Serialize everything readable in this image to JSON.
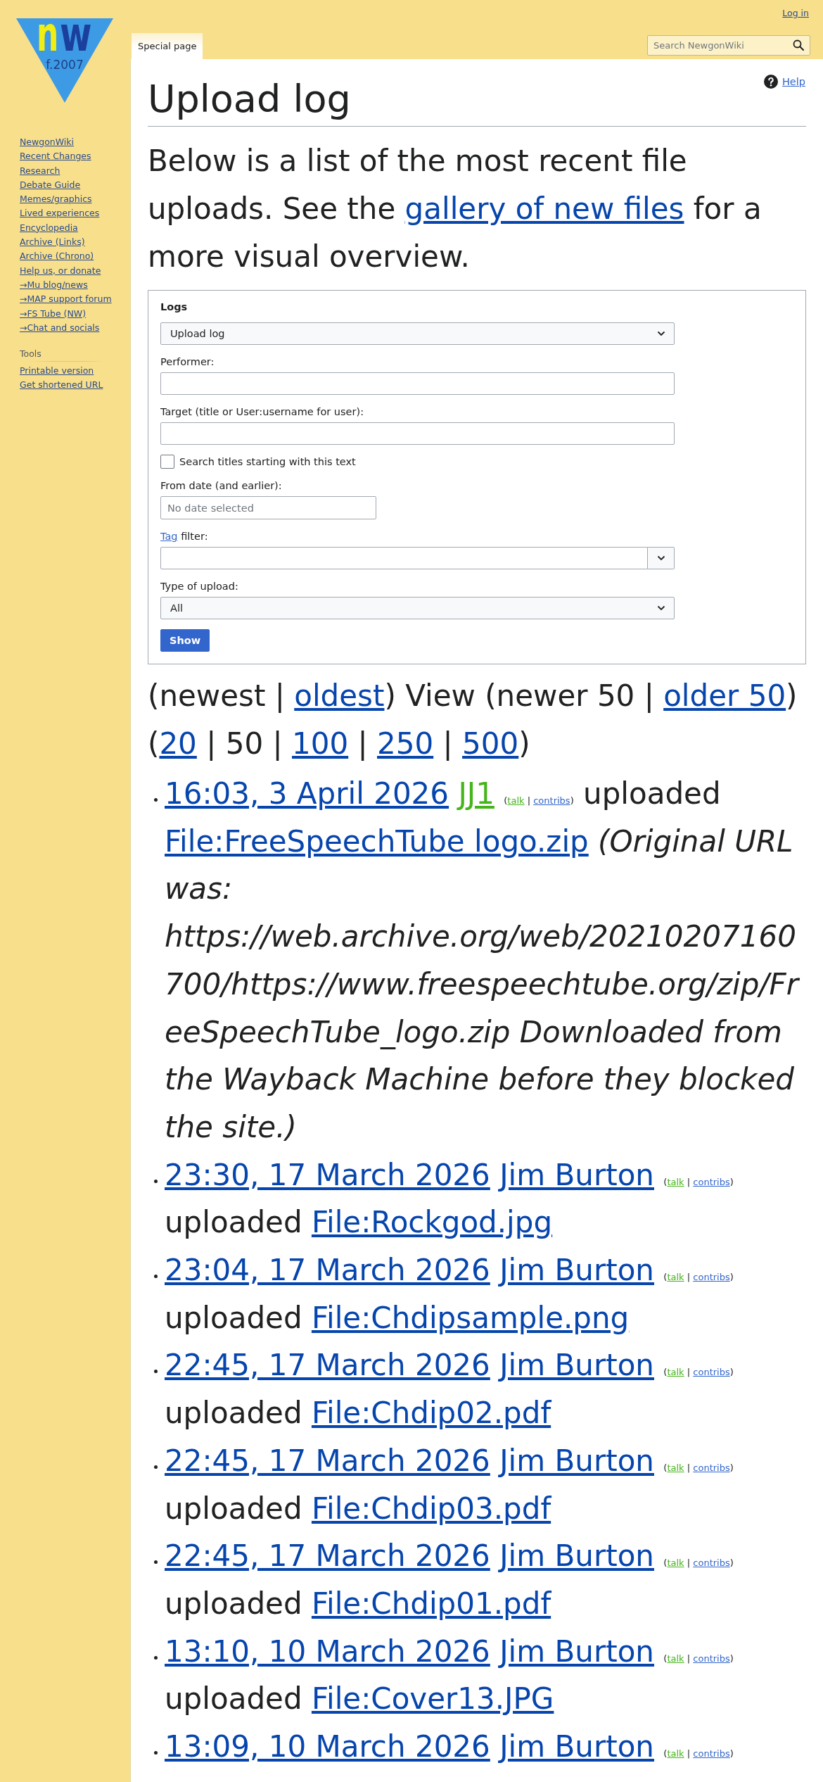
{
  "header": {
    "login": "Log in",
    "tabs": [
      {
        "label": "Special page",
        "selected": true
      }
    ],
    "search": {
      "placeholder": "Search NewgonWiki"
    }
  },
  "logo": {
    "letters": [
      {
        "text": "n",
        "color": "#f0ee12"
      },
      {
        "text": "w",
        "color": "#1b3f9c"
      }
    ],
    "caption": "f.2007"
  },
  "sidebar": {
    "navigation": [
      "NewgonWiki",
      "Recent Changes",
      "Research",
      "Debate Guide",
      "Memes/graphics",
      "Lived experiences",
      "Encyclopedia",
      "Archive (Links)",
      "Archive (Chrono)",
      "Help us, or donate",
      "→Mu blog/news",
      "→MAP support forum",
      "→FS Tube (NW)",
      "→Chat and socials"
    ],
    "tools": {
      "heading": "Tools",
      "items": [
        "Printable version",
        "Get shortened URL"
      ]
    }
  },
  "page": {
    "title": "Upload log",
    "help": "Help",
    "intro": [
      {
        "kind": "text",
        "text": "Below is a list of the most recent file uploads. See the "
      },
      {
        "kind": "link",
        "text": "gallery of new files"
      },
      {
        "kind": "text",
        "text": " for a more visual overview."
      }
    ]
  },
  "filter_form": {
    "title": "Logs",
    "fields": [
      {
        "kind": "select",
        "value": "Upload log"
      },
      {
        "kind": "text",
        "label": "Performer:"
      },
      {
        "kind": "text",
        "label": "Target (title or User:username for user):"
      },
      {
        "kind": "checkbox",
        "label": "Search titles starting with this text",
        "checked": false
      },
      {
        "kind": "date",
        "label": "From date (and earlier):",
        "placeholder": "No date selected"
      },
      {
        "kind": "combo",
        "label_link": "Tag",
        "label": "filter:"
      },
      {
        "kind": "select",
        "label": "Type of upload:",
        "value": "All"
      }
    ],
    "submit": "Show"
  },
  "pager": [
    {
      "kind": "text",
      "text": "(newest | "
    },
    {
      "kind": "link",
      "text": "oldest"
    },
    {
      "kind": "text",
      "text": ") View (newer 50 | "
    },
    {
      "kind": "link",
      "text": "older 50"
    },
    {
      "kind": "text",
      "text": ") ("
    },
    {
      "kind": "link",
      "text": "20"
    },
    {
      "kind": "text",
      "text": " | 50 | "
    },
    {
      "kind": "link",
      "text": "100"
    },
    {
      "kind": "text",
      "text": " | "
    },
    {
      "kind": "link",
      "text": "250"
    },
    {
      "kind": "text",
      "text": " | "
    },
    {
      "kind": "link",
      "text": "500"
    },
    {
      "kind": "text",
      "text": ")"
    }
  ],
  "log": [
    {
      "time": "16:03, 3 April 2026",
      "user": {
        "text": "JJ1",
        "missing": true
      },
      "tools": [
        {
          "kind": "text",
          "text": "("
        },
        {
          "kind": "link",
          "text": "talk",
          "missing": true
        },
        {
          "kind": "text",
          "text": " | "
        },
        {
          "kind": "link",
          "text": "contribs",
          "missing": false
        },
        {
          "kind": "text",
          "text": ")"
        }
      ],
      "action": "uploaded",
      "file": "File:FreeSpeechTube logo.zip",
      "comment": "(Original URL was: https://web.archive.org/web/20210207160700/https://www.freespeechtube.org/zip/FreeSpeechTube_logo.zip Downloaded from the Wayback Machine before they blocked the site.)"
    },
    {
      "time": "23:30, 17 March 2026",
      "user": {
        "text": "Jim Burton",
        "missing": false
      },
      "tools": [
        {
          "kind": "text",
          "text": "("
        },
        {
          "kind": "link",
          "text": "talk",
          "missing": true
        },
        {
          "kind": "text",
          "text": " | "
        },
        {
          "kind": "link",
          "text": "contribs",
          "missing": false
        },
        {
          "kind": "text",
          "text": ")"
        }
      ],
      "action": "uploaded",
      "file": "File:Rockgod.jpg"
    },
    {
      "time": "23:04, 17 March 2026",
      "user": {
        "text": "Jim Burton",
        "missing": false
      },
      "tools": [
        {
          "kind": "text",
          "text": "("
        },
        {
          "kind": "link",
          "text": "talk",
          "missing": true
        },
        {
          "kind": "text",
          "text": " | "
        },
        {
          "kind": "link",
          "text": "contribs",
          "missing": false
        },
        {
          "kind": "text",
          "text": ")"
        }
      ],
      "action": "uploaded",
      "file": "File:Chdipsample.png"
    },
    {
      "time": "22:45, 17 March 2026",
      "user": {
        "text": "Jim Burton",
        "missing": false
      },
      "tools": [
        {
          "kind": "text",
          "text": "("
        },
        {
          "kind": "link",
          "text": "talk",
          "missing": true
        },
        {
          "kind": "text",
          "text": " | "
        },
        {
          "kind": "link",
          "text": "contribs",
          "missing": false
        },
        {
          "kind": "text",
          "text": ")"
        }
      ],
      "action": "uploaded",
      "file": "File:Chdip02.pdf"
    },
    {
      "time": "22:45, 17 March 2026",
      "user": {
        "text": "Jim Burton",
        "missing": false
      },
      "tools": [
        {
          "kind": "text",
          "text": "("
        },
        {
          "kind": "link",
          "text": "talk",
          "missing": true
        },
        {
          "kind": "text",
          "text": " | "
        },
        {
          "kind": "link",
          "text": "contribs",
          "missing": false
        },
        {
          "kind": "text",
          "text": ")"
        }
      ],
      "action": "uploaded",
      "file": "File:Chdip03.pdf"
    },
    {
      "time": "22:45, 17 March 2026",
      "user": {
        "text": "Jim Burton",
        "missing": false
      },
      "tools": [
        {
          "kind": "text",
          "text": "("
        },
        {
          "kind": "link",
          "text": "talk",
          "missing": true
        },
        {
          "kind": "text",
          "text": " | "
        },
        {
          "kind": "link",
          "text": "contribs",
          "missing": false
        },
        {
          "kind": "text",
          "text": ")"
        }
      ],
      "action": "uploaded",
      "file": "File:Chdip01.pdf"
    },
    {
      "time": "13:10, 10 March 2026",
      "user": {
        "text": "Jim Burton",
        "missing": false
      },
      "tools": [
        {
          "kind": "text",
          "text": "("
        },
        {
          "kind": "link",
          "text": "talk",
          "missing": true
        },
        {
          "kind": "text",
          "text": " | "
        },
        {
          "kind": "link",
          "text": "contribs",
          "missing": false
        },
        {
          "kind": "text",
          "text": ")"
        }
      ],
      "action": "uploaded",
      "file": "File:Cover13.JPG"
    },
    {
      "time": "13:09, 10 March 2026",
      "user": {
        "text": "Jim Burton",
        "missing": false
      },
      "tools": [
        {
          "kind": "text",
          "text": "("
        },
        {
          "kind": "link",
          "text": "talk",
          "missing": true
        },
        {
          "kind": "text",
          "text": " | "
        },
        {
          "kind": "link",
          "text": "contribs",
          "missing": false
        },
        {
          "kind": "text",
          "text": ")"
        }
      ]
    }
  ]
}
